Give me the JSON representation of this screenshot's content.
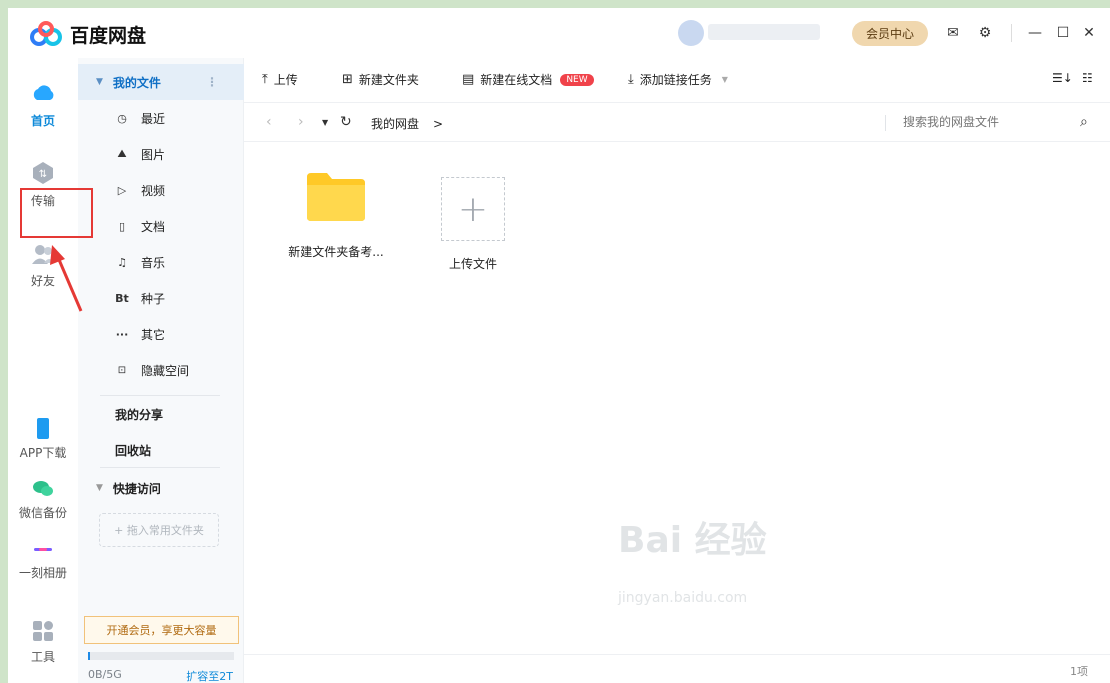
{
  "app": {
    "title": "百度网盘"
  },
  "header": {
    "vip_label": "会员中心"
  },
  "leftnav": {
    "items": [
      {
        "label": "首页",
        "icon": "cloud-home-icon"
      },
      {
        "label": "传输",
        "icon": "transfer-icon"
      },
      {
        "label": "好友",
        "icon": "friends-icon"
      },
      {
        "label": "APP下载",
        "icon": "phone-icon"
      },
      {
        "label": "微信备份",
        "icon": "wechat-icon"
      },
      {
        "label": "一刻相册",
        "icon": "album-icon"
      },
      {
        "label": "工具",
        "icon": "tools-icon"
      }
    ]
  },
  "tree": {
    "my_files": "我的文件",
    "items": [
      {
        "label": "最近",
        "icon": "clock-icon",
        "glyph": "◷"
      },
      {
        "label": "图片",
        "icon": "image-icon",
        "glyph": "⛰"
      },
      {
        "label": "视频",
        "icon": "play-icon",
        "glyph": "▷"
      },
      {
        "label": "文档",
        "icon": "doc-icon",
        "glyph": "▯"
      },
      {
        "label": "音乐",
        "icon": "headphone-icon",
        "glyph": "♫"
      },
      {
        "label": "种子",
        "icon": "bt-icon",
        "glyph": "Bt"
      },
      {
        "label": "其它",
        "icon": "more-icon",
        "glyph": "···"
      },
      {
        "label": "隐藏空间",
        "icon": "lock-icon",
        "glyph": "🔒"
      }
    ],
    "my_share": "我的分享",
    "recycle": "回收站",
    "quick_access": "快捷访问",
    "drag_hint": "+ 拖入常用文件夹",
    "promo": "开通会员，享更大容量",
    "quota_used": "0B/5G",
    "quota_link": "扩容至2T",
    "quota_fraction": 0.01
  },
  "toolbar": {
    "upload": "上传",
    "new_folder": "新建文件夹",
    "new_online_doc": "新建在线文档",
    "new_badge": "NEW",
    "add_link_task": "添加链接任务"
  },
  "path": {
    "crumb": "我的网盘",
    "crumb_arrow": ">",
    "search_placeholder": "搜索我的网盘文件"
  },
  "files": [
    {
      "name": "新建文件夹备考..."
    },
    {
      "name": "上传文件"
    }
  ],
  "status": {
    "count": "1项"
  },
  "watermark": {
    "text": "Bai 经验",
    "sub": "jingyan.baidu.com"
  },
  "colors": {
    "accent": "#0f8ad9",
    "folder": "#ffd247",
    "highlight": "#e53935"
  }
}
